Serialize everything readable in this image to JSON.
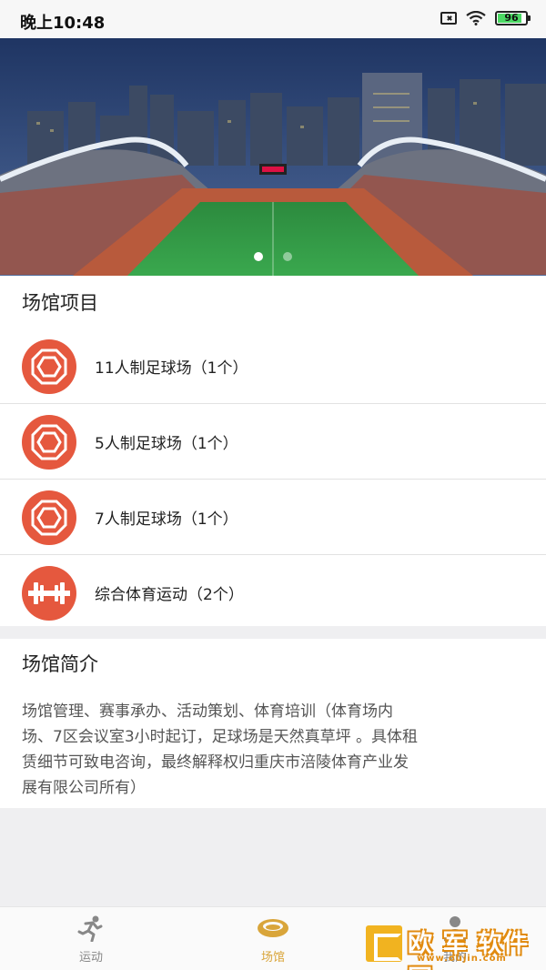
{
  "status_bar": {
    "time": "晚上10:48",
    "battery": "96"
  },
  "banner": {
    "slides": 2,
    "active_slide": 0
  },
  "venue_items": {
    "title": "场馆项目",
    "items": [
      {
        "label": "11人制足球场（1个）",
        "icon": "football-icon"
      },
      {
        "label": "5人制足球场（1个）",
        "icon": "football-icon"
      },
      {
        "label": "7人制足球场（1个）",
        "icon": "football-icon"
      },
      {
        "label": "综合体育运动（2个）",
        "icon": "dumbbell-icon"
      }
    ]
  },
  "intro": {
    "title": "场馆简介",
    "lines": [
      "场馆管理、赛事承办、活动策划、体育培训（体育场内",
      "场、7区会议室3小时起订，足球场是天然真草坪 。具体租",
      "赁细节可致电咨询，最终解释权归重庆市涪陵体育产业发",
      "展有限公司所有）"
    ]
  },
  "tabbar": {
    "tabs": [
      {
        "label": "运动",
        "icon": "running-icon",
        "active": false
      },
      {
        "label": "场馆",
        "icon": "stadium-icon",
        "active": true
      },
      {
        "label": "我的",
        "icon": "user-icon",
        "active": false
      }
    ]
  },
  "watermark": {
    "text": "欧 军 软件园",
    "sub": "www.oujin.com"
  },
  "colors": {
    "accent": "#e5583e",
    "active_tab": "#d9a53a"
  }
}
